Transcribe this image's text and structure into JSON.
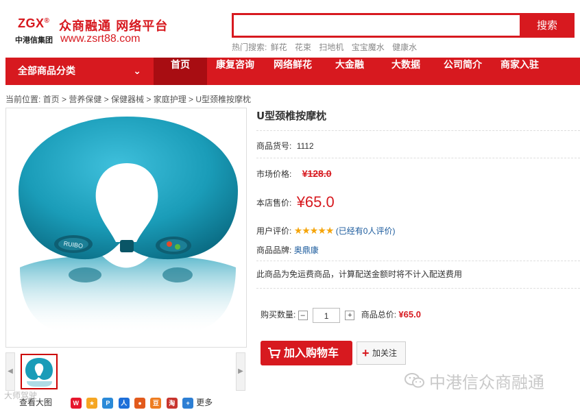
{
  "brand": {
    "logo_text": "ZGX",
    "logo_mark": "®",
    "group_name": "中港信集团",
    "platform_name": "众商融通 网络平台",
    "url": "www.zsrt88.com"
  },
  "search": {
    "placeholder": "",
    "button_label": "搜索",
    "hot_label": "热门搜索:",
    "hot_terms": [
      "鲜花",
      "花束",
      "扫地机",
      "宝宝魔水",
      "健康水"
    ]
  },
  "nav": {
    "all_categories": "全部商品分类",
    "items": [
      "首页",
      "康复咨询",
      "网络鲜花",
      "大金融",
      "大数据",
      "公司简介",
      "商家入驻"
    ],
    "active_index": 0
  },
  "breadcrumb": "当前位置: 首页 > 营养保健 > 保健器械 > 家庭护理 > U型颈椎按摩枕",
  "product": {
    "title": "U型颈椎按摩枕",
    "sku_label": "商品货号:",
    "sku": "1112",
    "market_price_label": "市场价格:",
    "market_price": "¥128.0",
    "shop_price_label": "本店售价:",
    "shop_price": "¥65.0",
    "rating_label": "用户评价:",
    "rating_stars": 5,
    "rating_text": "(已经有0人评价)",
    "brand_label": "商品品牌:",
    "brand": "奥鼎康",
    "shipping_note": "此商品为免运费商品，计算配送金额时将不计入配送费用",
    "qty_label": "购买数量:",
    "qty": "1",
    "total_label": "商品总价:",
    "total": "¥65.0",
    "pillow_text": "RUIBO"
  },
  "actions": {
    "add_to_cart": "加入购物车",
    "follow": "加关注"
  },
  "gallery": {
    "view_large": "查看大图",
    "share_more": "更多"
  },
  "watermarks": {
    "wechat": "中港信众商融通",
    "corner": "大师驾驶"
  },
  "colors": {
    "brand_red": "#d7191f",
    "nav_active": "#a80d12",
    "pillow_teal": "#1a9cb8",
    "star_gold": "#f5a50b",
    "link_blue": "#1a5a9c"
  }
}
